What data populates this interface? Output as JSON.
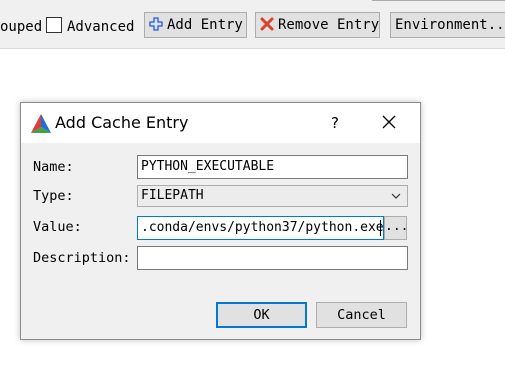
{
  "toolbar": {
    "grouped_label": "ouped",
    "advanced_label": "Advanced",
    "advanced_checked": false,
    "add_entry_label": "Add Entry",
    "remove_entry_label": "Remove Entry",
    "environment_label": "Environment..."
  },
  "dialog": {
    "title": "Add Cache Entry",
    "help_label": "?",
    "name_label": "Name:",
    "name_value": "PYTHON_EXECUTABLE",
    "type_label": "Type:",
    "type_value": "FILEPATH",
    "value_label": "Value:",
    "value_value": ".conda/envs/python37/python.exe",
    "browse_label": "...",
    "description_label": "Description:",
    "description_value": "",
    "ok_label": "OK",
    "cancel_label": "Cancel"
  },
  "colors": {
    "accent": "#0078d7",
    "add_icon": "#2b57c8",
    "remove_icon": "#d9412a",
    "logo_red": "#e53935",
    "logo_green": "#43a047",
    "logo_blue": "#1e6fd9"
  }
}
